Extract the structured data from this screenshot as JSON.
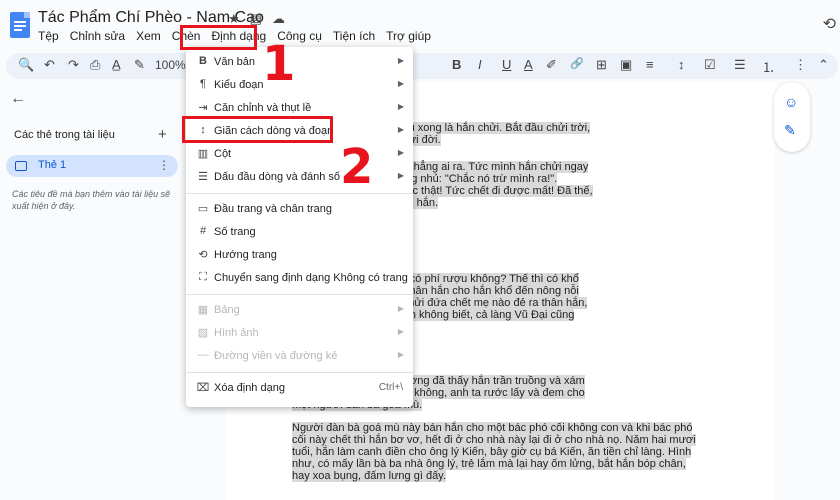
{
  "window": {
    "title": "Tác Phẩm Chí Phèo - Nam Cao",
    "title_icons": [
      "★",
      "▤",
      "☁"
    ]
  },
  "menu": [
    "Tệp",
    "Chỉnh sửa",
    "Xem",
    "Chèn",
    "Định dạng",
    "Công cụ",
    "Tiện ích",
    "Trợ giúp"
  ],
  "toolbar": {
    "zoom": "100%",
    "icons": [
      "search-icon",
      "undo-icon",
      "redo-icon",
      "print-icon",
      "spellcheck-icon",
      "paint-format-icon",
      "bold-icon",
      "italic-icon",
      "underline-icon",
      "text-color-icon",
      "highlight-icon",
      "link-icon",
      "comment-icon",
      "image-icon",
      "align-icon",
      "line-spacing-icon",
      "checklist-icon",
      "bullet-list-icon",
      "numbered-list-icon",
      "more-icon",
      "collapse-icon"
    ],
    "glyphs": {
      "search": "🔍",
      "undo": "↶",
      "redo": "↷",
      "print": "⎙",
      "spell": "A̲",
      "paint": "✎",
      "bold": "B",
      "italic": "I",
      "underline": "U",
      "text_color": "A",
      "highlight": "✐",
      "link": "🔗",
      "comment": "⊞",
      "image": "▣",
      "align": "≡",
      "line_spacing": "↕",
      "checklist": "☑",
      "bullets": "☰",
      "numbered": "⒈",
      "more": "⋮",
      "collapse": "⌃"
    }
  },
  "sidebar": {
    "heading": "Các thẻ trong tài liệu",
    "tab_label": "Thẻ 1",
    "hint": "Các tiêu đề mà bạn thêm vào tài liệu sẽ xuất hiện ở đây."
  },
  "format_menu": {
    "group1": [
      {
        "icon": "B",
        "label": "Văn bản",
        "arrow": "▶"
      },
      {
        "icon": "¶",
        "label": "Kiểu đoạn",
        "arrow": "▶"
      },
      {
        "icon": "⇥",
        "label": "Căn chỉnh và thụt lề",
        "arrow": "▶"
      },
      {
        "icon": "↕",
        "label": "Giãn cách dòng và đoạn",
        "arrow": "▶"
      },
      {
        "icon": "▥",
        "label": "Cột",
        "arrow": "▶"
      },
      {
        "icon": "☰",
        "label": "Dấu đầu dòng và đánh số",
        "arrow": "▶"
      }
    ],
    "group2": [
      {
        "icon": "▭",
        "label": "Đầu trang và chân trang"
      },
      {
        "icon": "#",
        "label": "Số trang"
      },
      {
        "icon": "⟲",
        "label": "Hướng trang"
      },
      {
        "icon": "⛶",
        "label": "Chuyển sang định dạng Không có trang"
      }
    ],
    "group3": [
      {
        "icon": "▦",
        "label": "Bảng",
        "arrow": "▶"
      },
      {
        "icon": "▨",
        "label": "Hình ảnh",
        "arrow": "▶"
      },
      {
        "icon": "—",
        "label": "Đường viền và đường kẻ",
        "arrow": "▶"
      }
    ],
    "group4": [
      {
        "icon": "⌧",
        "label": "Xóa định dạng",
        "shortcut": "Ctrl+\\"
      }
    ]
  },
  "annotations": {
    "step1": "1",
    "step2": "2"
  },
  "document": {
    "paragraphs": [
      [
        "ao giờ cũng thế, cứ rượu xong là hắn chửi. Bắt đầu chửi trời,",
        "ng nhà nào? Rồi hắn chửi đời."
      ],
      [
        "ới là tất cả nhưng cũng chẳng ai ra. Tức mình hắn chửi ngay",
        "ng cả làng Vũ Đại ai cũng nhủ: \"Chắc nó trừ mình ra!\".",
        "rức thật! Ồ thế này thì tức thật! Tức chết đi được mất! Đã thế,",
        "nào không chửi nhau với hắn."
      ],
      [
        "a điều. Mẹ kiếp! Thế thì có phí rượu không? Thế thì có khổ",
        "đứa chết mẹ nào đẻ ra thân hắn cho hắn khổ đến nông nỗi",
        "n cứ thế mà chửi, hắn chửi đứa chết mẹ nào đẻ ra thân hắn,",
        "nèo? Mà có trời biết! Hắn không biết, cả làng Vũ Đại cũng"
      ],
      [
        "n, một buổi sáng tinh sương đã thấy hắn trần truồng và xám",
        "ở để bên một lò gạch bỏ không, anh ta rước lấy và đem cho",
        "một người đàn bà goá mù."
      ],
      [
        "Người đàn bà goá mù này bán hắn cho một bác phó cối không con và khi bác phó",
        "cối này chết thì hắn bơ vơ, hết đi ở cho nhà này lại đi ở cho nhà nọ. Năm hai mươi",
        "tuổi, hắn làm canh điền cho ông lý Kiến, bây giờ cụ bá Kiến, ăn tiền chỉ làng. Hình",
        "như, có mấy lần bà ba nhà ông lý, trẻ lắm mà lại hay ốm lửng, bắt hắn bóp chân,",
        "hay xoa bụng, đấm lưng gì đấy."
      ]
    ]
  },
  "rail": {
    "icons": [
      "☺",
      "✎"
    ]
  },
  "colors": {
    "accent": "#0b57d0",
    "annotation": "#e8141d",
    "selection": "#d9d9d9"
  }
}
